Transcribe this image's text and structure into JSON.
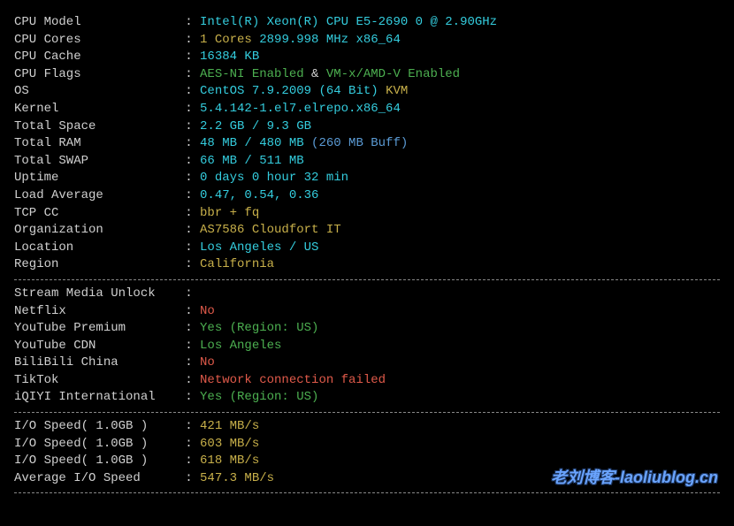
{
  "sysinfo": [
    {
      "label": "CPU Model",
      "segments": [
        {
          "text": "Intel(R) Xeon(R) CPU E5-2690 0 @ 2.90GHz",
          "cls": "cyan"
        }
      ]
    },
    {
      "label": "CPU Cores",
      "segments": [
        {
          "text": "1 Cores ",
          "cls": "yellow"
        },
        {
          "text": "2899.998 MHz x86_64",
          "cls": "cyan"
        }
      ]
    },
    {
      "label": "CPU Cache",
      "segments": [
        {
          "text": "16384 KB",
          "cls": "cyan"
        }
      ]
    },
    {
      "label": "CPU Flags",
      "segments": [
        {
          "text": "AES-NI Enabled ",
          "cls": "green"
        },
        {
          "text": "& ",
          "cls": "white"
        },
        {
          "text": "VM-x/AMD-V Enabled",
          "cls": "green"
        }
      ]
    },
    {
      "label": "OS",
      "segments": [
        {
          "text": "CentOS 7.9.2009 (64 Bit) ",
          "cls": "cyan"
        },
        {
          "text": "KVM",
          "cls": "yellow"
        }
      ]
    },
    {
      "label": "Kernel",
      "segments": [
        {
          "text": "5.4.142-1.el7.elrepo.x86_64",
          "cls": "cyan"
        }
      ]
    },
    {
      "label": "Total Space",
      "segments": [
        {
          "text": "2.2 GB / 9.3 GB",
          "cls": "cyan"
        }
      ]
    },
    {
      "label": "Total RAM",
      "segments": [
        {
          "text": "48 MB / 480 MB ",
          "cls": "cyan"
        },
        {
          "text": "(260 MB Buff)",
          "cls": "blue"
        }
      ]
    },
    {
      "label": "Total SWAP",
      "segments": [
        {
          "text": "66 MB / 511 MB",
          "cls": "cyan"
        }
      ]
    },
    {
      "label": "Uptime",
      "segments": [
        {
          "text": "0 days 0 hour 32 min",
          "cls": "cyan"
        }
      ]
    },
    {
      "label": "Load Average",
      "segments": [
        {
          "text": "0.47, 0.54, 0.36",
          "cls": "cyan"
        }
      ]
    },
    {
      "label": "TCP CC",
      "segments": [
        {
          "text": "bbr + fq",
          "cls": "yellow"
        }
      ]
    },
    {
      "label": "Organization",
      "segments": [
        {
          "text": "AS7586 Cloudfort IT",
          "cls": "yellow"
        }
      ]
    },
    {
      "label": "Location",
      "segments": [
        {
          "text": "Los Angeles / US",
          "cls": "cyan"
        }
      ]
    },
    {
      "label": "Region",
      "segments": [
        {
          "text": "California",
          "cls": "yellow"
        }
      ]
    }
  ],
  "stream": [
    {
      "label": "Stream Media Unlock",
      "segments": []
    },
    {
      "label": "Netflix",
      "segments": [
        {
          "text": "No",
          "cls": "red"
        }
      ]
    },
    {
      "label": "YouTube Premium",
      "segments": [
        {
          "text": "Yes (Region: US)",
          "cls": "green"
        }
      ]
    },
    {
      "label": "YouTube CDN",
      "segments": [
        {
          "text": "Los Angeles",
          "cls": "green"
        }
      ]
    },
    {
      "label": "BiliBili China",
      "segments": [
        {
          "text": "No",
          "cls": "red"
        }
      ]
    },
    {
      "label": "TikTok",
      "segments": [
        {
          "text": "Network connection failed",
          "cls": "red"
        }
      ]
    },
    {
      "label": "iQIYI International",
      "segments": [
        {
          "text": "Yes (Region: US)",
          "cls": "green"
        }
      ]
    }
  ],
  "io": [
    {
      "label": "I/O Speed( 1.0GB )",
      "segments": [
        {
          "text": "421 MB/s",
          "cls": "yellow"
        }
      ]
    },
    {
      "label": "I/O Speed( 1.0GB )",
      "segments": [
        {
          "text": "603 MB/s",
          "cls": "yellow"
        }
      ]
    },
    {
      "label": "I/O Speed( 1.0GB )",
      "segments": [
        {
          "text": "618 MB/s",
          "cls": "yellow"
        }
      ]
    },
    {
      "label": "Average I/O Speed",
      "segments": [
        {
          "text": "547.3 MB/s",
          "cls": "yellow"
        }
      ]
    }
  ],
  "watermark": "老刘博客-laoliublog.cn"
}
